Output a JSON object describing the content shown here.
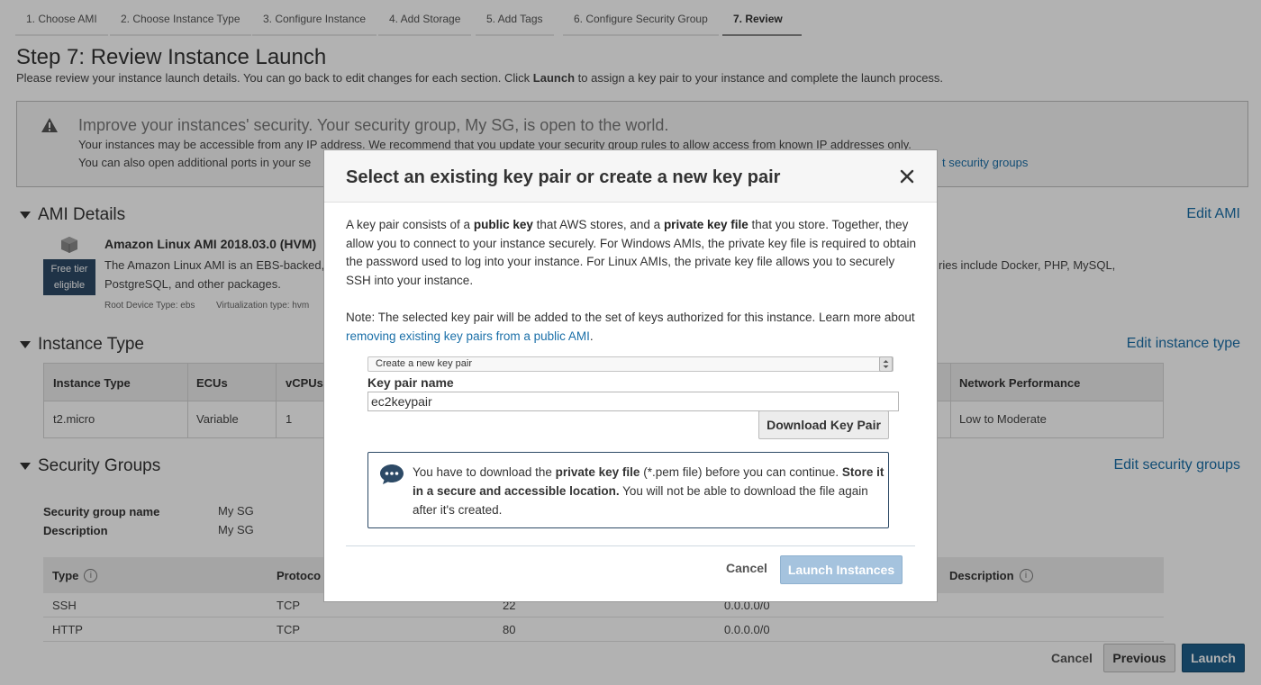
{
  "wizard": {
    "steps": [
      "1. Choose AMI",
      "2. Choose Instance Type",
      "3. Configure Instance",
      "4. Add Storage",
      "5. Add Tags",
      "6. Configure Security Group",
      "7. Review"
    ],
    "active_step": "7. Review"
  },
  "page": {
    "title": "Step 7: Review Instance Launch",
    "desc_pre": "Please review your instance launch details. You can go back to edit changes for each section. Click ",
    "desc_bold": "Launch",
    "desc_post": " to assign a key pair to your instance and complete the launch process."
  },
  "warning": {
    "title": "Improve your instances' security. Your security group, My SG, is open to the world.",
    "line1": "Your instances may be accessible from any IP address. We recommend that you update your security group rules to allow access from known IP addresses only.",
    "line2": "You can also open additional ports in your se",
    "link_fragment": "t security groups"
  },
  "ami": {
    "section_title": "AMI Details",
    "edit_label": "Edit AMI",
    "name": "Amazon Linux AMI 2018.03.0 (HVM)",
    "free_tier_line1": "Free tier",
    "free_tier_line2": "eligible",
    "desc_left": "The Amazon Linux AMI is an EBS-backed, ",
    "desc_right": "ries include Docker, PHP, MySQL,",
    "desc_line2": "PostgreSQL, and other packages.",
    "root_device": "Root Device Type: ebs",
    "virtualization": "Virtualization type: hvm"
  },
  "instance_type": {
    "section_title": "Instance Type",
    "edit_label": "Edit instance type",
    "headers": {
      "type": "Instance Type",
      "ecus": "ECUs",
      "vcpus": "vCPUs",
      "network": "Network Performance"
    },
    "row": {
      "type": "t2.micro",
      "ecus": "Variable",
      "vcpus": "1",
      "network": "Low to Moderate"
    }
  },
  "security_groups": {
    "section_title": "Security Groups",
    "edit_label": "Edit security groups",
    "name_label": "Security group name",
    "name_value": "My SG",
    "desc_label": "Description",
    "desc_value": "My SG",
    "rule_headers": {
      "type": "Type",
      "protocol": "Protoco",
      "description": "Description"
    },
    "rules": [
      {
        "type": "SSH",
        "protocol": "TCP",
        "port": "22",
        "source": "0.0.0.0/0"
      },
      {
        "type": "HTTP",
        "protocol": "TCP",
        "port": "80",
        "source": "0.0.0.0/0"
      }
    ]
  },
  "footer": {
    "cancel": "Cancel",
    "previous": "Previous",
    "launch": "Launch"
  },
  "modal": {
    "title": "Select an existing key pair or create a new key pair",
    "p1_a": "A key pair consists of a ",
    "p1_b": "public key",
    "p1_c": " that AWS stores, and a ",
    "p1_d": "private key file",
    "p1_e": " that you store. Together, they allow you to connect to your instance securely. For Windows AMIs, the private key file is required to obtain the password used to log into your instance. For Linux AMIs, the private key file allows you to securely SSH into your instance.",
    "p2_a": "Note: The selected key pair will be added to the set of keys authorized for this instance. Learn more about ",
    "p2_link": "removing existing key pairs from a public AMI",
    "p2_b": ".",
    "select_value": "Create a new key pair",
    "key_pair_label": "Key pair name",
    "key_pair_value": "ec2keypair",
    "download_button": "Download Key Pair",
    "notice_a": "You have to download the ",
    "notice_b": "private key file",
    "notice_c": " (*.pem file) before you can continue. ",
    "notice_d": "Store it in a secure and accessible location.",
    "notice_e": " You will not be able to download the file again after it's created.",
    "cancel": "Cancel",
    "launch": "Launch Instances"
  }
}
